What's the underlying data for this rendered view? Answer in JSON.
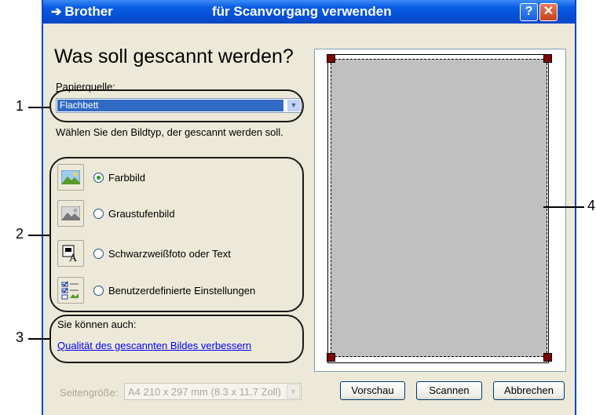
{
  "window": {
    "title_left": "Brother",
    "title_center": "für Scanvorgang verwenden",
    "help_glyph": "?",
    "close_glyph": "✕"
  },
  "main": {
    "heading": "Was soll gescannt werden?",
    "source_label": "Papierquelle:",
    "source_value": "Flachbett",
    "image_type_prompt": "Wählen Sie den Bildtyp, der gescannt werden soll.",
    "options": [
      {
        "label": "Farbbild",
        "icon": "color-photo-icon",
        "checked": true
      },
      {
        "label": "Graustufenbild",
        "icon": "grayscale-photo-icon",
        "checked": false
      },
      {
        "label": "Schwarzweißfoto oder Text",
        "icon": "bw-text-icon",
        "checked": false
      },
      {
        "label": "Benutzerdefinierte Einstellungen",
        "icon": "custom-settings-icon",
        "checked": false
      }
    ],
    "also_label": "Sie können auch:",
    "quality_link": "Qualität des gescannten Bildes verbessern",
    "page_size_label": "Seitengröße:",
    "page_size_value": "A4 210 x 297 mm (8.3 x 11.7 Zoll)"
  },
  "buttons": {
    "preview": "Vorschau",
    "scan": "Scannen",
    "cancel": "Abbrechen"
  },
  "callouts": {
    "n1": "1",
    "n2": "2",
    "n3": "3",
    "n4": "4"
  },
  "colors": {
    "titlebar": "#0552d8",
    "selection": "#316ac5",
    "preview_area": "#c0c0c0",
    "handle": "#800000"
  }
}
